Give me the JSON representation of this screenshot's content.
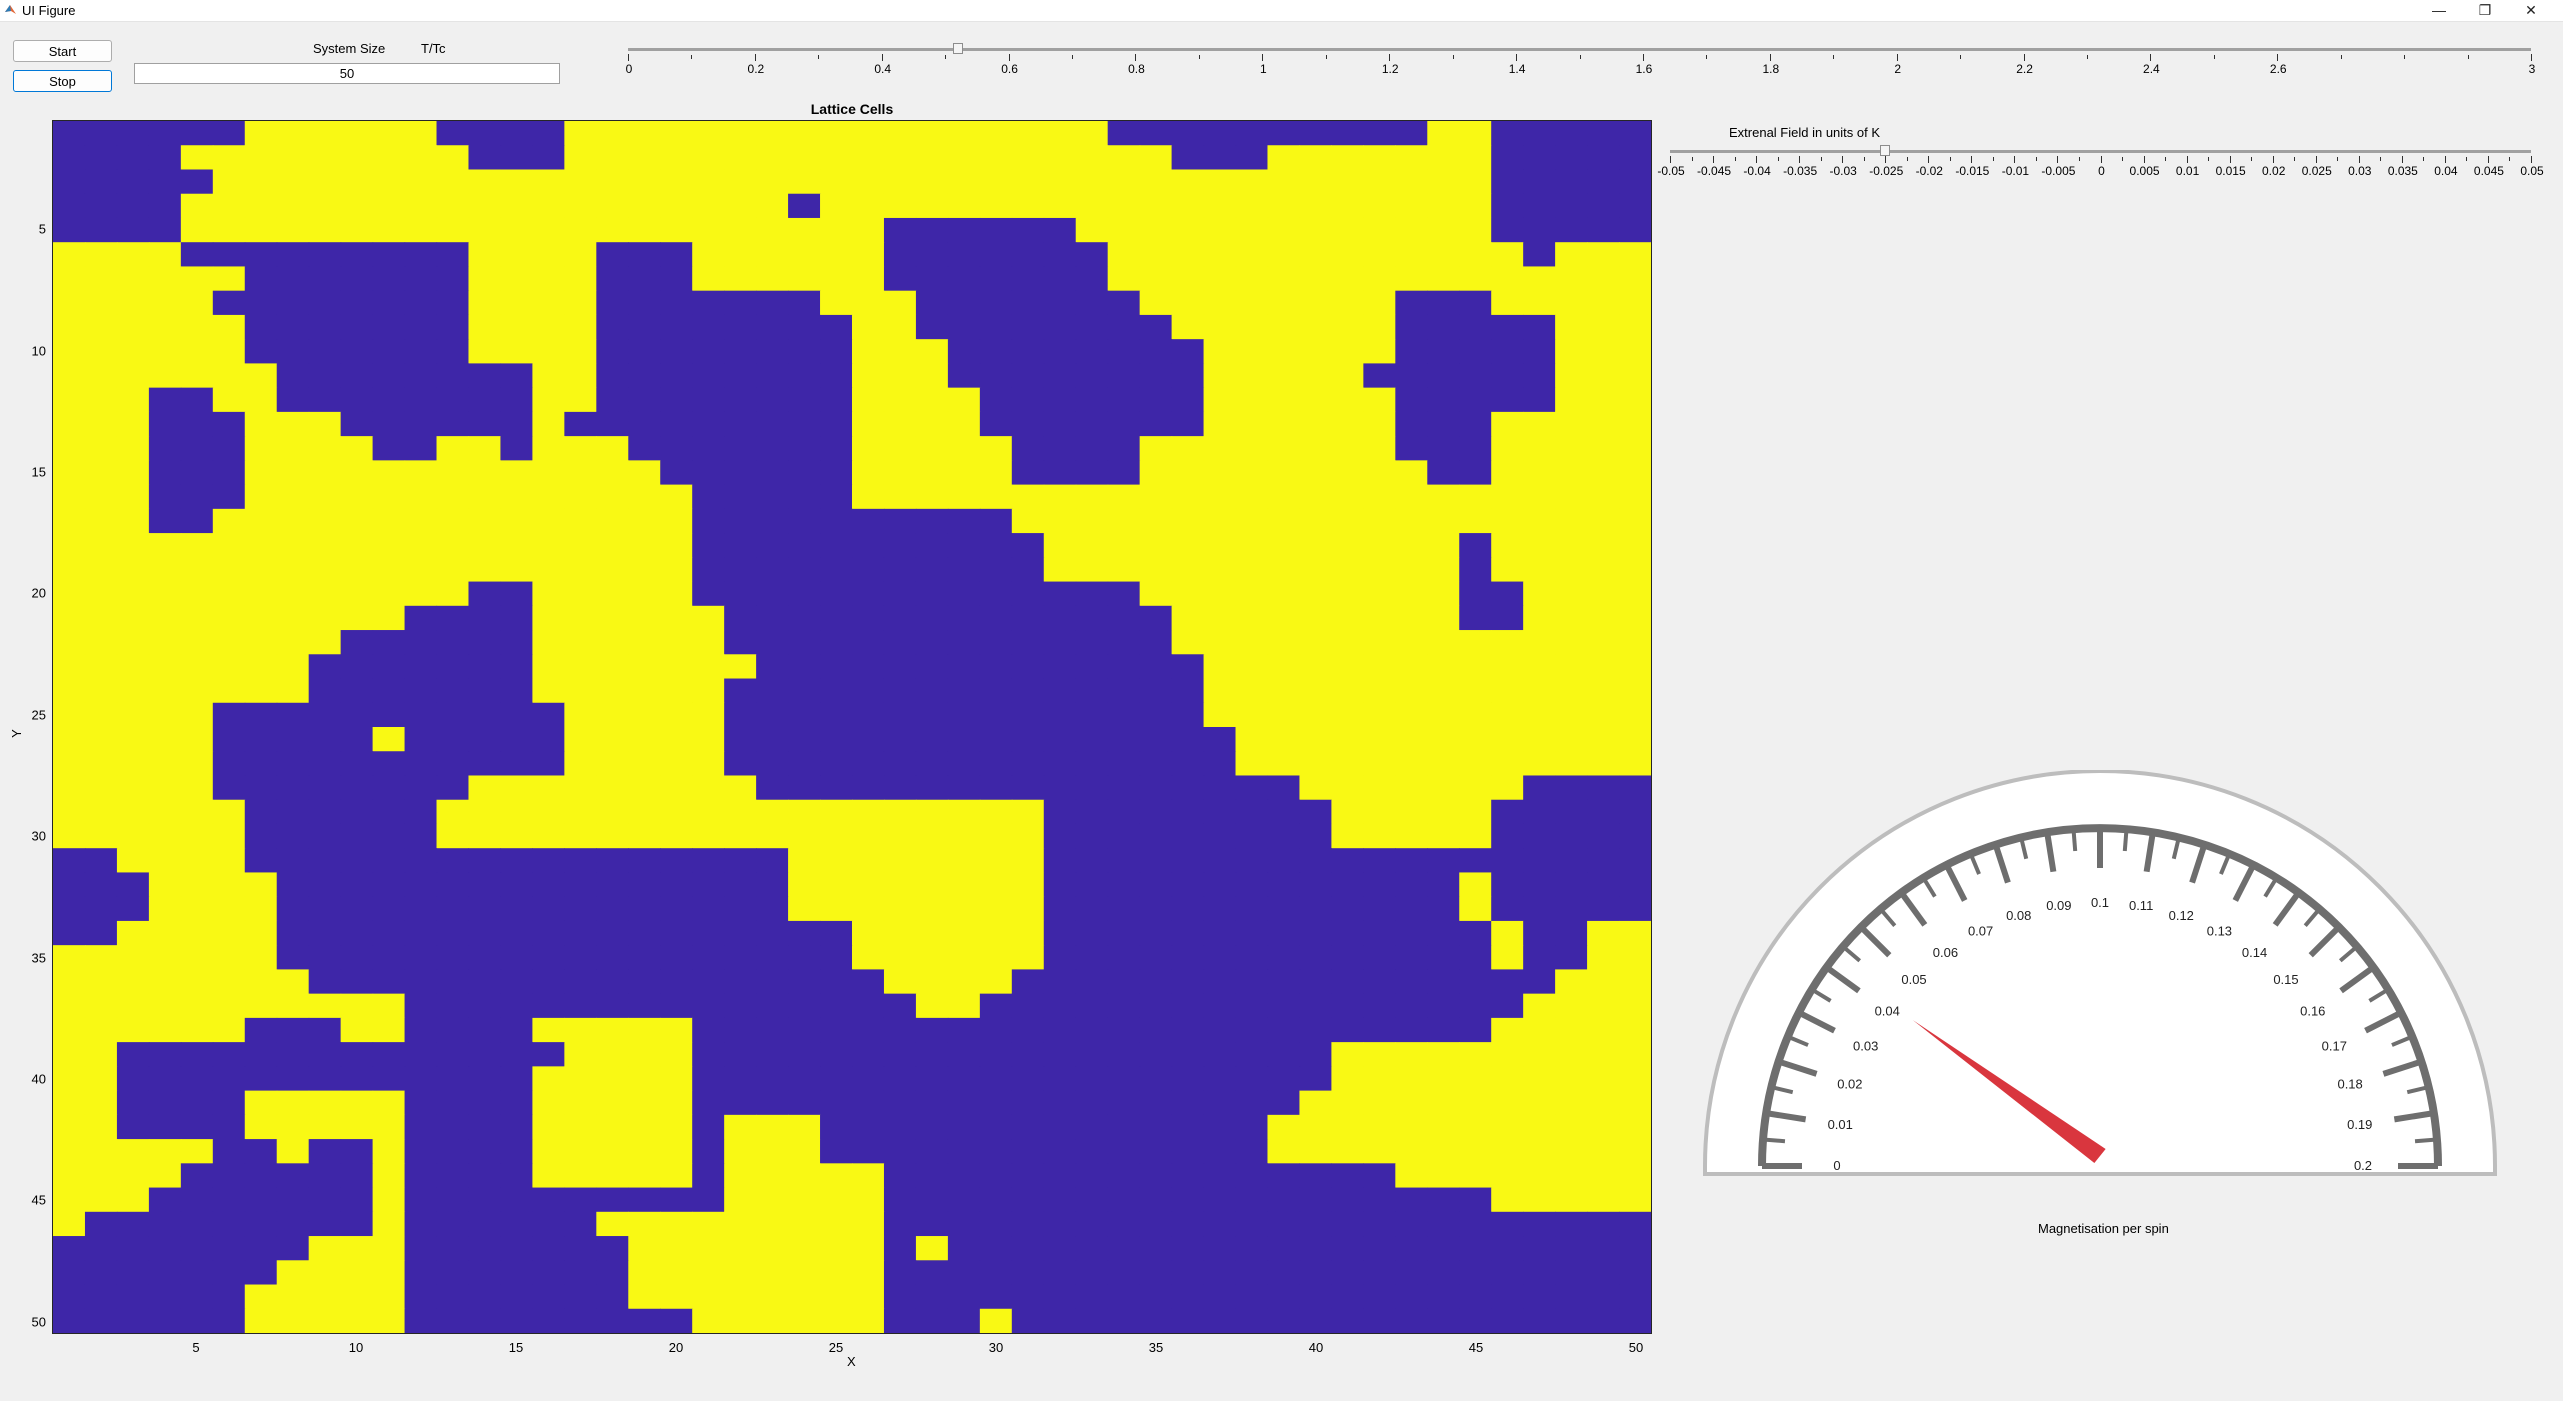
{
  "window": {
    "title": "UI Figure",
    "minimize_icon": "minimize-icon",
    "restore_icon": "restore-icon",
    "close_icon": "close-icon"
  },
  "controls": {
    "start_label": "Start",
    "stop_label": "Stop",
    "system_size_label": "System Size",
    "ttc_label": "T/Tc",
    "system_size_value": "50"
  },
  "temperature_slider": {
    "min": 0,
    "max": 3,
    "value": 0.52,
    "tick_labels": [
      "0",
      "0.2",
      "0.4",
      "0.6",
      "0.8",
      "1",
      "1.2",
      "1.4",
      "1.6",
      "1.8",
      "2",
      "2.2",
      "2.4",
      "2.6",
      "3"
    ],
    "tick_values": [
      0,
      0.2,
      0.4,
      0.6,
      0.8,
      1,
      1.2,
      1.4,
      1.6,
      1.8,
      2,
      2.2,
      2.4,
      2.6,
      3
    ]
  },
  "field_slider": {
    "label": "Extrenal Field in units of K",
    "min": -0.05,
    "max": 0.05,
    "value": -0.025,
    "tick_labels": [
      "-0.05",
      "-0.045",
      "-0.04",
      "-0.035",
      "-0.03",
      "-0.025",
      "-0.02",
      "-0.015",
      "-0.01",
      "-0.005",
      "0",
      "0.005",
      "0.01",
      "0.015",
      "0.02",
      "0.025",
      "0.03",
      "0.035",
      "0.04",
      "0.045",
      "0.05"
    ]
  },
  "lattice_plot": {
    "title": "Lattice Cells",
    "xlabel": "X",
    "ylabel": "Y",
    "x_ticks": [
      "5",
      "10",
      "15",
      "20",
      "25",
      "30",
      "35",
      "40",
      "45",
      "50"
    ],
    "y_ticks": [
      "5",
      "10",
      "15",
      "20",
      "25",
      "30",
      "35",
      "40",
      "45",
      "50"
    ],
    "colors": {
      "spin_up": "#f9f914",
      "spin_down": "#3e26a8"
    }
  },
  "gauge": {
    "label": "Magnetisation per spin",
    "min": 0,
    "max": 0.2,
    "value": 0.043,
    "tick_labels": [
      "0",
      "0.01",
      "0.02",
      "0.03",
      "0.04",
      "0.05",
      "0.06",
      "0.07",
      "0.08",
      "0.09",
      "0.1",
      "0.11",
      "0.12",
      "0.13",
      "0.14",
      "0.15",
      "0.16",
      "0.17",
      "0.18",
      "0.19",
      "0.2"
    ],
    "needle_color": "#d9363e"
  }
}
